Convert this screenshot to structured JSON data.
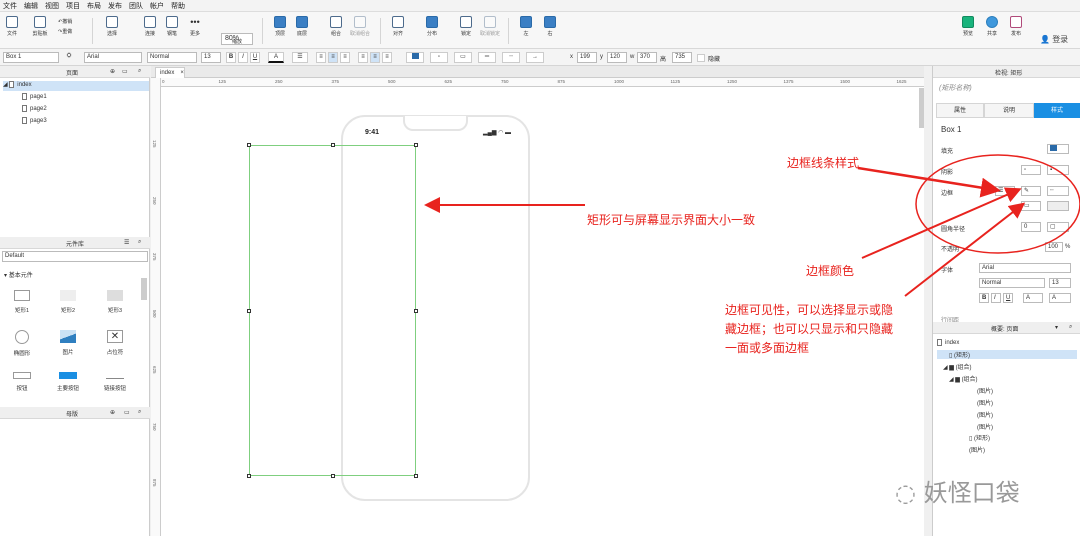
{
  "menu": [
    "文件",
    "编辑",
    "视图",
    "项目",
    "布局",
    "发布",
    "团队",
    "帐户",
    "帮助"
  ],
  "toolbar": {
    "buttons": [
      {
        "label": "文件"
      },
      {
        "label": "剪贴板"
      },
      {
        "label": "撤销"
      },
      {
        "label": "重做"
      },
      {
        "label": "选择"
      },
      {
        "label": "连接"
      },
      {
        "label": "钢笔"
      },
      {
        "label": "更多"
      },
      {
        "label": "缩放"
      },
      {
        "label": "顶层"
      },
      {
        "label": "底层"
      },
      {
        "label": "组合"
      },
      {
        "label": "取消组合"
      },
      {
        "label": "对齐"
      },
      {
        "label": "分布"
      },
      {
        "label": "锁定"
      },
      {
        "label": "取消锁定"
      },
      {
        "label": "左"
      },
      {
        "label": "右"
      },
      {
        "label": "预览"
      },
      {
        "label": "共享"
      },
      {
        "label": "发布"
      }
    ],
    "zoom": "80%",
    "login": "登录"
  },
  "format": {
    "element_name": "Box 1",
    "font": "Arial",
    "style": "Normal",
    "size": "13",
    "x_label": "x",
    "x": "199",
    "y_label": "y",
    "y": "120",
    "w_label": "w",
    "w": "370",
    "h_label": "高",
    "h": "735",
    "hidden_label": "隐藏"
  },
  "pages": {
    "title": "页面",
    "root": "index",
    "items": [
      "page1",
      "page2",
      "page3"
    ]
  },
  "library": {
    "title": "元件库",
    "selected": "Default",
    "group": "基本元件",
    "widgets": [
      "矩形1",
      "矩形2",
      "矩形3",
      "椭圆形",
      "图片",
      "占位符",
      "按钮",
      "主要按钮",
      "链接按钮"
    ]
  },
  "masters": {
    "title": "母版"
  },
  "canvas": {
    "tab": "index",
    "ruler_h": [
      "0",
      "125",
      "250",
      "375",
      "500",
      "625",
      "750",
      "875",
      "1000",
      "1125",
      "1250",
      "1375",
      "1500",
      "1625"
    ],
    "ruler_v": [
      "125",
      "250",
      "375",
      "500",
      "625",
      "750",
      "875"
    ],
    "phone_time": "9:41"
  },
  "inspector": {
    "header": "检视: 矩形",
    "shape_name_placeholder": "(矩形名称)",
    "tabs": [
      "属性",
      "说明",
      "样式"
    ],
    "active_tab": "样式",
    "style_name": "Box 1",
    "labels": [
      "填充",
      "阴影",
      "边框",
      "圆角半径",
      "不透明",
      "字体"
    ],
    "radius": "0",
    "opacity": "100",
    "opacity_unit": "%",
    "font": "Arial",
    "font_style": "Normal",
    "font_size": "13",
    "more_label": "行间距"
  },
  "outline": {
    "title": "概要: 页面",
    "items": [
      {
        "label": "index",
        "indent": 0
      },
      {
        "label": "(矩形)",
        "indent": 1
      },
      {
        "label": "(组合)",
        "indent": 1
      },
      {
        "label": "(组合)",
        "indent": 2
      },
      {
        "label": "(图片)",
        "indent": 3
      },
      {
        "label": "(图片)",
        "indent": 3
      },
      {
        "label": "(图片)",
        "indent": 3
      },
      {
        "label": "(图片)",
        "indent": 3
      },
      {
        "label": "(矩形)",
        "indent": 3
      },
      {
        "label": "(图片)",
        "indent": 2
      }
    ]
  },
  "annotations": {
    "rect_size": "矩形可与屏幕显示界面大小一致",
    "border_style": "边框线条样式",
    "border_color": "边框颜色",
    "border_visibility_1": "边框可见性，可以选择显示或隐",
    "border_visibility_2": "藏边框；也可以只显示和只隐藏",
    "border_visibility_3": "一面或多面边框"
  },
  "watermark": "妖怪口袋",
  "colors": {
    "accent": "#1a8fe3",
    "annotation": "#e8231e",
    "selection": "#7fcf7f"
  }
}
